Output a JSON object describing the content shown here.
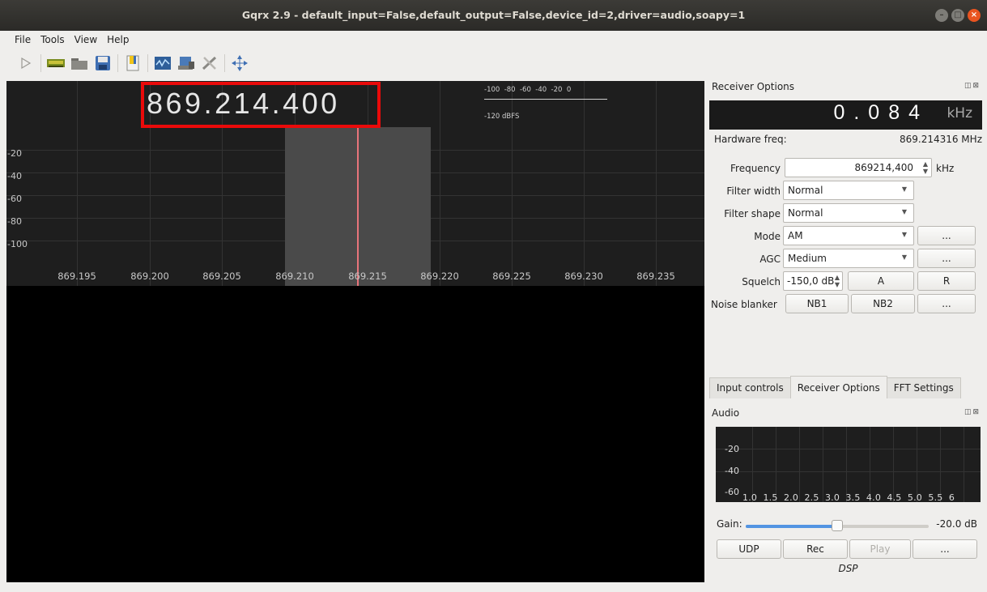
{
  "window": {
    "title": "Gqrx 2.9 - default_input=False,default_output=False,device_id=2,driver=audio,soapy=1"
  },
  "menu": [
    "File",
    "Tools",
    "View",
    "Help"
  ],
  "toolbar": {
    "icons": [
      "play-icon",
      "hardware-icon",
      "open-folder-icon",
      "save-icon",
      "bookmark-icon",
      "dsp-icon",
      "device-config-icon",
      "tools-icon",
      "center-fft-icon"
    ]
  },
  "plotter": {
    "frequency": "869.214.400",
    "db_labels": [
      "-20",
      "-40",
      "-60",
      "-80",
      "-100"
    ],
    "freq_labels": [
      "869.195",
      "869.200",
      "869.205",
      "869.210",
      "869.215",
      "869.220",
      "869.225",
      "869.230",
      "869.235"
    ],
    "smeter_ticks": "-100  -80  -60  -40  -20  0",
    "smeter_unit": "-120 dBFS"
  },
  "receiver": {
    "title": "Receiver Options",
    "offset_digits": "0.084",
    "offset_unit": "kHz",
    "hw_freq_label": "Hardware freq:",
    "hw_freq_value": "869.214316 MHz",
    "frequency_label": "Frequency",
    "frequency_value": "869214,400",
    "frequency_unit": "kHz",
    "filter_width_label": "Filter width",
    "filter_width_value": "Normal",
    "filter_shape_label": "Filter shape",
    "filter_shape_value": "Normal",
    "mode_label": "Mode",
    "mode_value": "AM",
    "agc_label": "AGC",
    "agc_value": "Medium",
    "more_label": "...",
    "squelch_label": "Squelch",
    "squelch_value": "-150,0 dB",
    "squelch_a": "A",
    "squelch_r": "R",
    "noise_blanker_label": "Noise blanker",
    "nb1": "NB1",
    "nb2": "NB2"
  },
  "tabs": [
    "Input controls",
    "Receiver Options",
    "FFT Settings"
  ],
  "audio": {
    "title": "Audio",
    "db_labels": [
      "-20",
      "-40",
      "-60"
    ],
    "freq_labels": "1.0  1.5  2.0  2.5  3.0  3.5  4.0  4.5  5.0  5.5  6",
    "gain_label": "Gain:",
    "gain_value": "-20.0 dB",
    "gain_level": 0.5,
    "udp": "UDP",
    "rec": "Rec",
    "play": "Play",
    "more": "...",
    "dsp": "DSP"
  }
}
